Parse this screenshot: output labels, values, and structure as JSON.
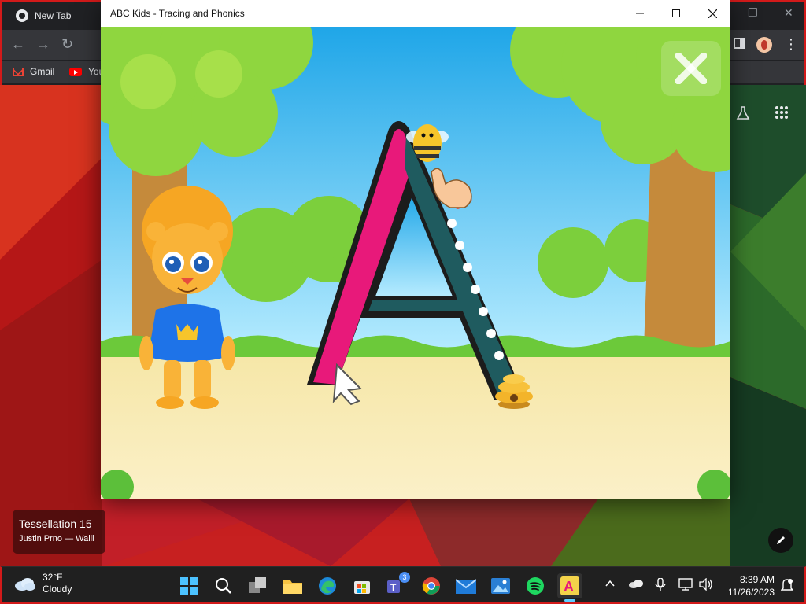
{
  "browser": {
    "tab_title": "New Tab",
    "bookmarks": [
      {
        "label": "Gmail",
        "icon": "gmail-icon"
      },
      {
        "label": "You",
        "icon": "youtube-icon"
      }
    ]
  },
  "app_window": {
    "title": "ABC Kids - Tracing and Phonics",
    "game": {
      "letter": "A",
      "character": "lion-cub",
      "close_icon": "close-icon"
    }
  },
  "wallpaper_widget": {
    "title": "Tessellation 15",
    "credit": "Justin Prno — Walli"
  },
  "taskbar": {
    "weather": {
      "temperature": "32°F",
      "condition": "Cloudy"
    },
    "apps": [
      {
        "name": "start",
        "icon": "windows-icon"
      },
      {
        "name": "search",
        "icon": "search-icon"
      },
      {
        "name": "task-view",
        "icon": "task-view-icon"
      },
      {
        "name": "file-explorer",
        "icon": "folder-icon"
      },
      {
        "name": "edge",
        "icon": "edge-icon"
      },
      {
        "name": "store",
        "icon": "store-icon"
      },
      {
        "name": "teams",
        "icon": "teams-icon",
        "badge": "3"
      },
      {
        "name": "chrome",
        "icon": "chrome-icon"
      },
      {
        "name": "mail",
        "icon": "mail-icon"
      },
      {
        "name": "photos",
        "icon": "photos-icon"
      },
      {
        "name": "spotify",
        "icon": "spotify-icon"
      },
      {
        "name": "abc-kids",
        "icon": "abc-kids-icon",
        "active": true
      }
    ],
    "clock": {
      "time": "8:39 AM",
      "date": "11/26/2023"
    }
  },
  "colors": {
    "accent": "#60cdff",
    "letter_pink": "#e8197a",
    "letter_teal": "#1f5b5f",
    "sky": "#4fc3f7",
    "ground": "#f4e4a4"
  }
}
